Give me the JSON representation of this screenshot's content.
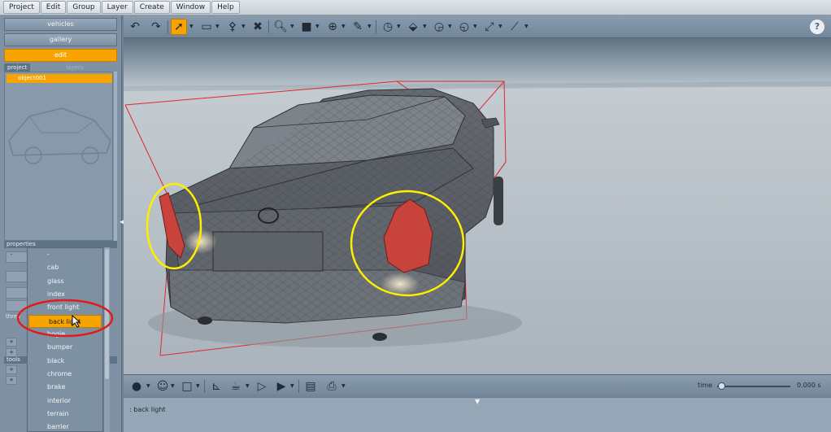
{
  "menu": [
    "Project",
    "Edit",
    "Group",
    "Layer",
    "Create",
    "Window",
    "Help"
  ],
  "left_panel": {
    "modes": [
      {
        "label": "vehicles",
        "active": false
      },
      {
        "label": "gallery",
        "active": false
      },
      {
        "label": "edit",
        "active": true
      }
    ],
    "tabs": {
      "project": "project",
      "layers": "layers"
    },
    "object_row": "object001",
    "properties_header": "properties",
    "prop_label_partial": "thres",
    "tools_header": "tools",
    "plus": "+",
    "minus": "-"
  },
  "dropdown": {
    "items": [
      "-",
      "cab",
      "glass",
      "index",
      "front light",
      "back light",
      "bogie",
      "bumper",
      "black",
      "chrome",
      "brake",
      "interior",
      "terrain",
      "barrier"
    ],
    "selected_index": 5
  },
  "toolbar": {
    "help": "?",
    "icons": [
      "undo-icon",
      "redo-icon",
      "select-arrow-icon",
      "box-select-icon",
      "transform-icon",
      "delete-icon",
      "zoom-icon",
      "material-icon",
      "move-icon",
      "paint-icon",
      "gauge1-icon",
      "tilt-icon",
      "gauge2-icon",
      "gauge3-icon",
      "measure-icon",
      "tape-icon"
    ]
  },
  "bottombar": {
    "time_label": "time",
    "time_value": "0.000 s",
    "time_fraction": 0.05
  },
  "status": {
    "message": ": back light"
  },
  "colors": {
    "accent": "#f7a400",
    "highlight_ring": "#ffee00",
    "annotation_ring": "#e21a1a",
    "bounding_box": "#e0282e",
    "tail_light": "#c7433b"
  }
}
